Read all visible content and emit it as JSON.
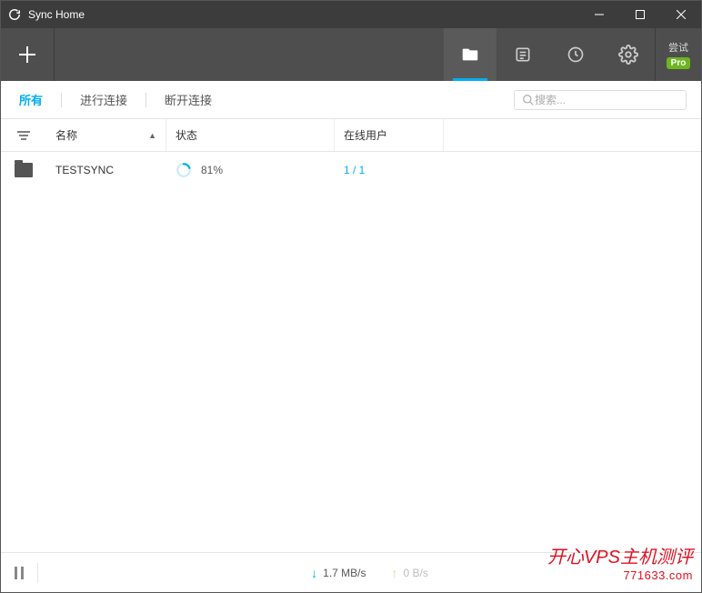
{
  "titlebar": {
    "title": "Sync Home"
  },
  "toolbar": {
    "pro_label": "尝试",
    "pro_badge": "Pro"
  },
  "filters": {
    "all": "所有",
    "connecting": "进行连接",
    "disconnected": "断开连接"
  },
  "search": {
    "placeholder": "搜索..."
  },
  "columns": {
    "name": "名称",
    "status": "状态",
    "users": "在线用户"
  },
  "rows": [
    {
      "name": "TESTSYNC",
      "progress": "81%",
      "users": "1 / 1"
    }
  ],
  "statusbar": {
    "download": "1.7 MB/s",
    "upload": "0 B/s"
  },
  "watermark": {
    "text": "开心VPS主机测评",
    "domain": "771633.com"
  }
}
